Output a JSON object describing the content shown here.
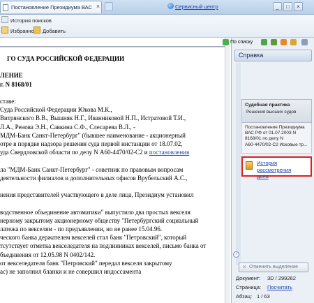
{
  "tab": {
    "title": "Постановление Президиума ВАС РФ ...",
    "close": "×"
  },
  "header": {
    "center_link": "Сервисный центр"
  },
  "window_buttons": [
    "_",
    "□",
    "×"
  ],
  "toolbar": {
    "history": "История поисков",
    "favorites": "Избранное",
    "add": "Добавить"
  },
  "doc_tools": {
    "by_list": "По списку"
  },
  "document": {
    "lines": [
      "ГО СУДА РОССИЙСКОЙ ФЕДЕРАЦИИ",
      "",
      "ЛЕНИЕ",
      "г. N 8168/01",
      "",
      "ставе:",
      "Суда Российской Федерации Юкова М.К.,",
      "Витрянского В.В., Вышняк Н.Г., Иванниковой Н.П., Истратовой Т.И.,",
      "Л.А., Ренова Э.Н., Савкина С.Ф., Слесарева В.Л., -",
      "МДМ-Банк Санкт-Петербург\" (бывшее наименование - акционерный",
      "отре в порядке надзора решения суда первой инстанции от 18.07.02,",
      "уда Свердловской области по делу N А60-4470/02-С2 и ",
      "",
      "ла \"МДМ-Банк Санкт-Петербург\" - советник по правовым вопросам",
      "деятельности филиалов и дополнительных офисов Врубельский А.С.,",
      "",
      "нения представителей участвующего в деле лица, Президиум установил",
      "",
      "водственное объединение автоматики\" выпустило два простых векселя",
      "нерному закрытому акционерному обществу \"Петербургский социальный",
      "латежа по векселям - по предъявлении, но не ранее 15.04.96.",
      "ческого банка держателем векселей стал банк \"Петровский\", который",
      "тсутствует отметка векселедателя на подлинниках векселей, письмо банка от",
      "бъединения от 12.05.98 N 0402/142.",
      "от векселедателя банк \"Петровский\" передал векселя закрытому",
      "ас) не заполнил бланки и не совершил индоссамента"
    ],
    "link_text": "постановления"
  },
  "panel": {
    "title": "Справка",
    "card_type": "Судебная практика",
    "card_sub": "Решения высших судов",
    "card_desc": [
      "Постановление Президиума",
      "ВАС РФ от 01.07.2003 N",
      "8168/01 по делу N",
      "А60-4470/02-С2 Исковые тр..."
    ],
    "history_link": [
      "История рассмотрения",
      "дела"
    ],
    "unselect": "Отменить выделение",
    "doc_label": "Документ:",
    "doc_value": "3D / 299262",
    "page_label": "Страница:",
    "page_value": "Посчитать",
    "para_label": "Абзац:",
    "para_value": "1 / 63"
  },
  "colors": {
    "accent": "#1a45a8",
    "highlight": "#e0201c"
  }
}
